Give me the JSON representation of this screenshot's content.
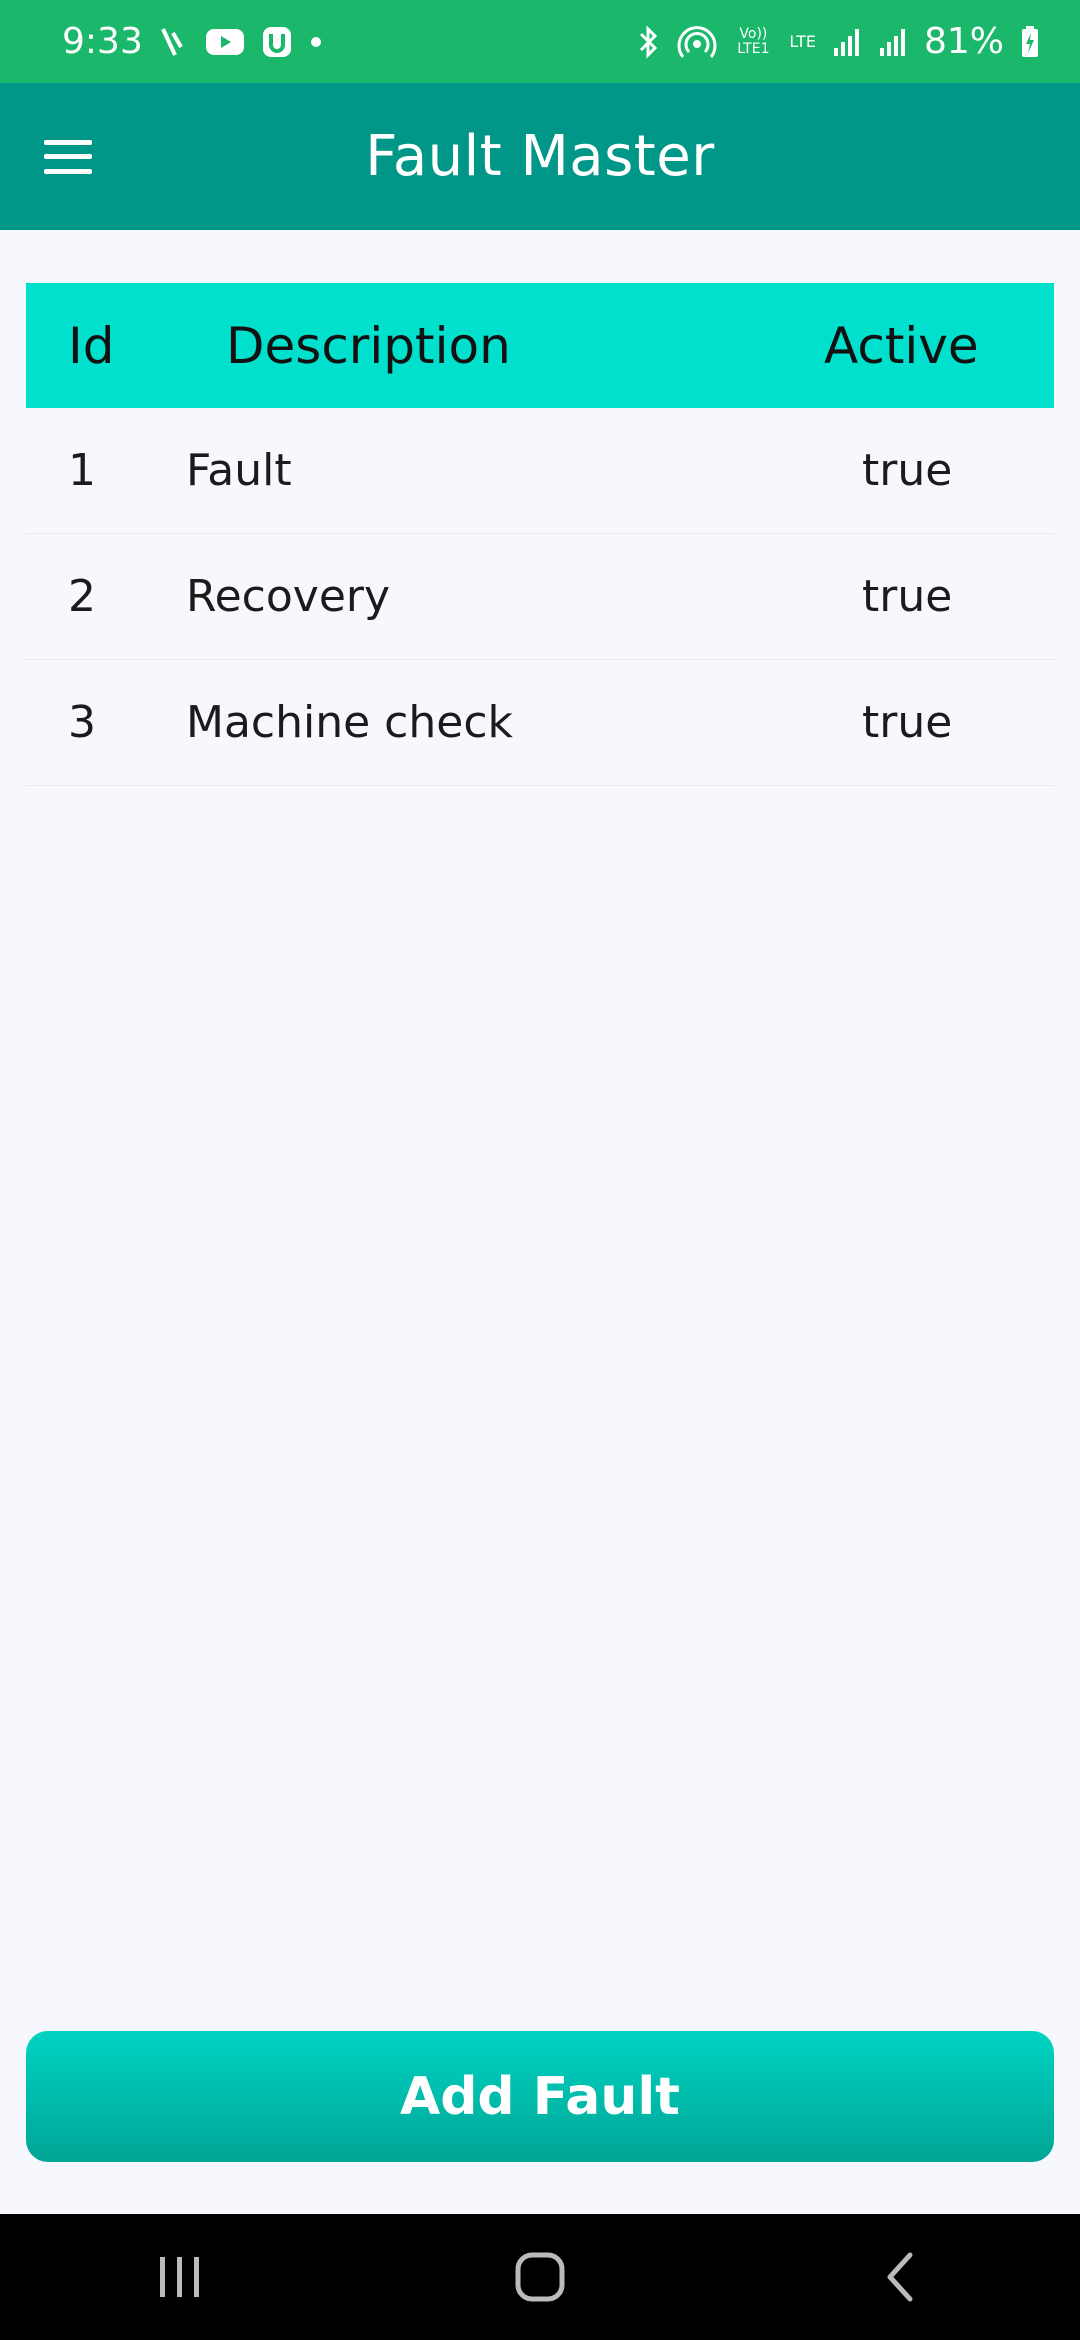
{
  "status_bar": {
    "time": "9:33",
    "battery_text": "81%",
    "network_text": "LTE",
    "volte_text": "Vo)) LTE1"
  },
  "app_bar": {
    "title": "Fault Master"
  },
  "table": {
    "headers": [
      "Id",
      "Description",
      "Active"
    ],
    "rows": [
      {
        "id": "1",
        "description": "Fault",
        "active": "true"
      },
      {
        "id": "2",
        "description": "Recovery",
        "active": "true"
      },
      {
        "id": "3",
        "description": "Machine check",
        "active": "true"
      }
    ]
  },
  "actions": {
    "add_label": "Add Fault"
  },
  "colors": {
    "status_bar": "#1bb86b",
    "app_bar": "#009788",
    "table_header": "#00e0cc",
    "button_top": "#00d3c2",
    "button_bottom": "#00a596",
    "background": "#f6f8fe"
  },
  "icons": {
    "menu": "hamburger-menu-icon",
    "recents": "recents-icon",
    "home": "home-icon",
    "back": "back-icon"
  }
}
